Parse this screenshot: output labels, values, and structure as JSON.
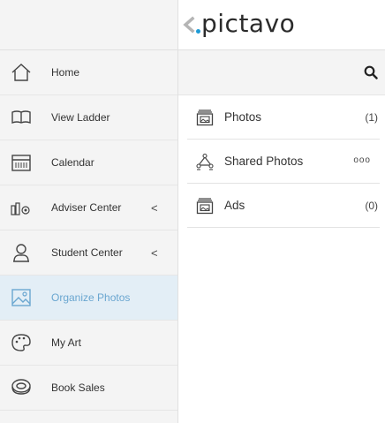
{
  "header": {
    "logo_text": "pictavo"
  },
  "sidebar": {
    "items": [
      {
        "label": "Home",
        "icon": "home-icon"
      },
      {
        "label": "View Ladder",
        "icon": "book-icon"
      },
      {
        "label": "Calendar",
        "icon": "calendar-icon"
      },
      {
        "label": "Adviser Center",
        "icon": "adviser-icon",
        "chevron": "<"
      },
      {
        "label": "Student Center",
        "icon": "student-icon",
        "chevron": "<"
      },
      {
        "label": "Organize Photos",
        "icon": "photo-icon",
        "active": true
      },
      {
        "label": "My Art",
        "icon": "palette-icon"
      },
      {
        "label": "Book Sales",
        "icon": "money-icon"
      }
    ]
  },
  "main": {
    "search_icon": "search-icon",
    "folders": [
      {
        "label": "Photos",
        "count": "(1)",
        "icon": "photo-album-icon"
      },
      {
        "label": "Shared Photos",
        "more": "ooo",
        "icon": "shared-photos-icon"
      },
      {
        "label": "Ads",
        "count": "(0)",
        "icon": "ads-album-icon"
      }
    ]
  },
  "colors": {
    "accent": "#6aa6d0",
    "active_bg": "#e3eef6",
    "sidebar_bg": "#f4f4f4",
    "logo_dot": "#1d9ad6"
  }
}
